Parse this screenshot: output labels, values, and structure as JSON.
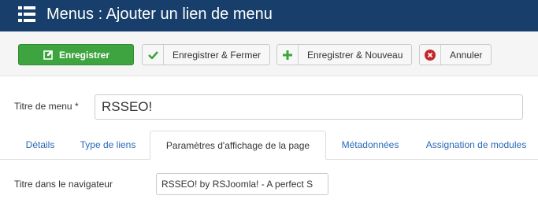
{
  "header": {
    "title": "Menus : Ajouter un lien de menu",
    "icon": "list-icon",
    "background": "#183f6b"
  },
  "toolbar": {
    "save": {
      "label": "Enregistrer",
      "icon": "edit-icon",
      "color": "#3ea43f"
    },
    "save_close": {
      "label": "Enregistrer & Fermer",
      "icon": "check-icon"
    },
    "save_new": {
      "label": "Enregistrer & Nouveau",
      "icon": "plus-icon"
    },
    "cancel": {
      "label": "Annuler",
      "icon": "cancel-circle-icon"
    }
  },
  "form": {
    "title_label": "Titre de menu",
    "required_mark": "*",
    "title_value": "RSSEO!"
  },
  "tabs": [
    {
      "label": "Détails",
      "active": false
    },
    {
      "label": "Type de liens",
      "active": false
    },
    {
      "label": "Paramètres d'affichage de la page",
      "active": true
    },
    {
      "label": "Métadonnées",
      "active": false
    },
    {
      "label": "Assignation de modules",
      "active": false
    }
  ],
  "page_display": {
    "browser_title_label": "Titre dans le navigateur",
    "browser_title_value": "RSSEO! by RSJoomla! - A perfect S"
  }
}
